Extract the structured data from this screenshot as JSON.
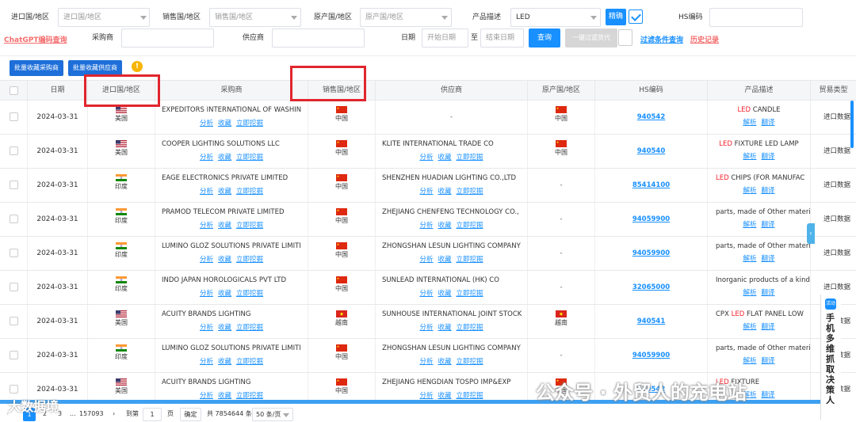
{
  "filters": {
    "import_country_label": "进口国/地区",
    "import_country_placeholder": "进口国/地区",
    "sales_country_label": "销售国/地区",
    "sales_country_placeholder": "销售国/地区",
    "origin_country_label": "原产国/地区",
    "origin_country_placeholder": "原产国/地区",
    "product_desc_label": "产品描述",
    "product_desc_value": "LED",
    "exact_button": "精确",
    "hs_code_label": "HS编码",
    "chatgpt_link": "ChatGPT编码查询",
    "buyer_label": "采购商",
    "supplier_label": "供应商",
    "date_label": "日期",
    "start_date_placeholder": "开始日期",
    "date_sep": "至",
    "end_date_placeholder": "结束日期",
    "search_button": "查询",
    "one_click_filter_button": "一键过滤货代",
    "filter_query_link": "过滤条件查询",
    "history_link": "历史记录"
  },
  "toolbar": {
    "collect_buyers": "批量收藏采购商",
    "collect_suppliers": "批量收藏供应商",
    "warn_icon_text": "!"
  },
  "table": {
    "headers": [
      "日期",
      "进口国/地区",
      "采购商",
      "销售国/地区",
      "供应商",
      "原产国/地区",
      "HS编码",
      "产品描述",
      "贸易类型"
    ],
    "actions": {
      "analyze": "分析",
      "collect": "收藏",
      "mine": "立即挖掘",
      "parse": "解析",
      "translate": "翻译"
    },
    "rows": [
      {
        "date": "2024-03-31",
        "import_country": "美国",
        "import_flag": "us",
        "buyer": "EXPEDITORS INTERNATIONAL OF WASHIN",
        "sales_country": "中国",
        "sales_flag": "cn",
        "supplier": "-",
        "supplier_actions": false,
        "origin": "中国",
        "origin_flag": "cn",
        "hs": "940542",
        "desc_pre": "",
        "desc_red": "LED",
        "desc_post": " CANDLE",
        "desc_center": true,
        "trade": "进口数据"
      },
      {
        "date": "2024-03-31",
        "import_country": "美国",
        "import_flag": "us",
        "buyer": "COOPER LIGHTING SOLUTIONS LLC",
        "sales_country": "中国",
        "sales_flag": "cn",
        "supplier": "KLITE INTERNATIONAL TRADE CO",
        "supplier_actions": true,
        "origin": "中国",
        "origin_flag": "cn",
        "hs": "940540",
        "desc_pre": "",
        "desc_red": "LED",
        "desc_post": " FIXTURE LED LAMP",
        "desc_center": true,
        "trade": "进口数据"
      },
      {
        "date": "2024-03-31",
        "import_country": "印度",
        "import_flag": "in",
        "buyer": "EAGE ELECTRONICS PRIVATE LIMITED",
        "sales_country": "中国",
        "sales_flag": "cn",
        "supplier": "SHENZHEN HUADIAN LIGHTING CO.,LTD",
        "supplier_actions": true,
        "origin": "-",
        "origin_flag": "",
        "hs": "85414100",
        "desc_pre": "",
        "desc_red": "LED",
        "desc_post": " CHIPS (FOR MANUFAC",
        "desc_center": false,
        "trade": "进口数据"
      },
      {
        "date": "2024-03-31",
        "import_country": "印度",
        "import_flag": "in",
        "buyer": "PRAMOD TELECOM PRIVATE LIMITED",
        "sales_country": "中国",
        "sales_flag": "cn",
        "supplier": "ZHEJIANG CHENFENG TECHNOLOGY CO.,",
        "supplier_actions": true,
        "origin": "-",
        "origin_flag": "",
        "hs": "94059900",
        "desc_pre": "parts, made of Other materials",
        "desc_red": "",
        "desc_post": "",
        "desc_center": false,
        "trade": "进口数据"
      },
      {
        "date": "2024-03-31",
        "import_country": "印度",
        "import_flag": "in",
        "buyer": "LUMINO GLOZ SOLUTIONS PRIVATE LIMITI",
        "sales_country": "中国",
        "sales_flag": "cn",
        "supplier": "ZHONGSHAN LESUN LIGHTING COMPANY",
        "supplier_actions": true,
        "origin": "-",
        "origin_flag": "",
        "hs": "94059900",
        "desc_pre": "parts, made of Other materials",
        "desc_red": "",
        "desc_post": "",
        "desc_center": false,
        "trade": "进口数据"
      },
      {
        "date": "2024-03-31",
        "import_country": "印度",
        "import_flag": "in",
        "buyer": "INDO JAPAN HOROLOGICALS PVT LTD",
        "sales_country": "中国",
        "sales_flag": "cn",
        "supplier": "SUNLEAD INTERNATIONAL (HK) CO",
        "supplier_actions": true,
        "origin": "-",
        "origin_flag": "",
        "hs": "32065000",
        "desc_pre": "Inorganic products of a kind u",
        "desc_red": "",
        "desc_post": "",
        "desc_center": false,
        "trade": "进口数据"
      },
      {
        "date": "2024-03-31",
        "import_country": "美国",
        "import_flag": "us",
        "buyer": "ACUITY BRANDS LIGHTING",
        "sales_country": "越南",
        "sales_flag": "vn",
        "supplier": "SUNHOUSE INTERNATIONAL JOINT STOCK",
        "supplier_actions": true,
        "origin": "越南",
        "origin_flag": "vn",
        "hs": "940541",
        "desc_pre": "CPX ",
        "desc_red": "LED",
        "desc_post": " FLAT PANEL LOW",
        "desc_center": false,
        "trade": "进口数据"
      },
      {
        "date": "2024-03-31",
        "import_country": "印度",
        "import_flag": "in",
        "buyer": "LUMINO GLOZ SOLUTIONS PRIVATE LIMITI",
        "sales_country": "中国",
        "sales_flag": "cn",
        "supplier": "ZHONGSHAN LESUN LIGHTING COMPANY",
        "supplier_actions": true,
        "origin": "-",
        "origin_flag": "",
        "hs": "94059900",
        "desc_pre": "parts, made of Other materials",
        "desc_red": "",
        "desc_post": "",
        "desc_center": false,
        "trade": "进口数据"
      },
      {
        "date": "2024-03-31",
        "import_country": "美国",
        "import_flag": "us",
        "buyer": "ACUITY BRANDS LIGHTING",
        "sales_country": "中国",
        "sales_flag": "cn",
        "supplier": "ZHEJIANG HENGDIAN TOSPO IMP&EXP",
        "supplier_actions": true,
        "origin": "中国",
        "origin_flag": "cn",
        "hs": "940542",
        "desc_pre": "",
        "desc_red": "LED",
        "desc_post": " FIXTURE",
        "desc_center": false,
        "trade": "进口数据"
      }
    ]
  },
  "pager": {
    "current": "1",
    "page2": "2",
    "page3": "3",
    "ellipsis": "...",
    "last": "157093",
    "goto_label": "到第",
    "goto_value": "1",
    "page_unit": "页",
    "confirm": "确定",
    "total": "共 7854644 条",
    "page_size": "50 条/页"
  },
  "watermark": {
    "left": "大数据境",
    "right": "公众号 · 外贸人的充电站"
  },
  "side_panel": {
    "badge": "活动",
    "text": "手机多维抓取决策人"
  },
  "colors": {
    "accent": "#1890ff",
    "highlight_box": "#e0262d",
    "red_keyword": "#f5222d"
  }
}
